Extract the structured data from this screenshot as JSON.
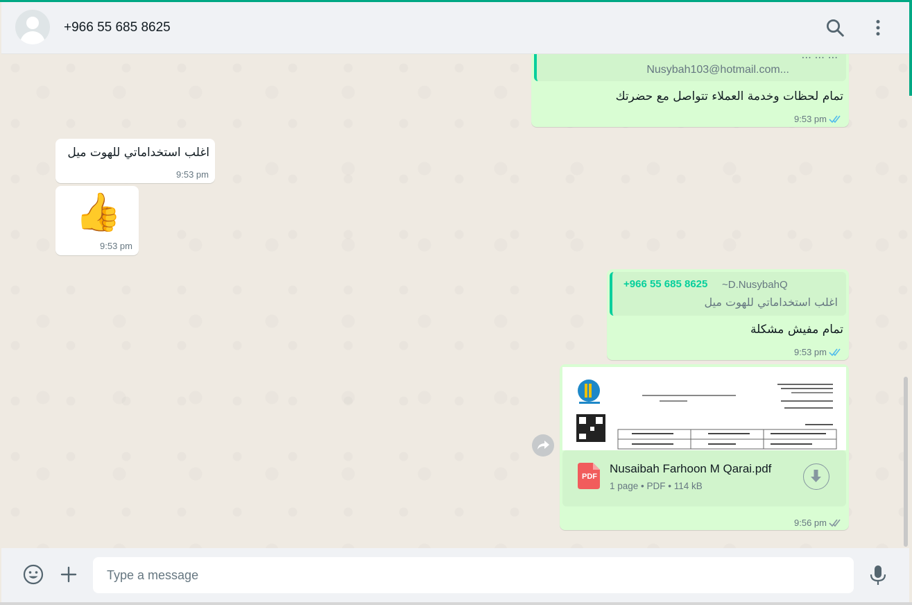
{
  "colors": {
    "accent": "#00a884",
    "outgoing_bubble": "#d9fdd3",
    "incoming_bubble": "#ffffff",
    "read_ticks": "#53bdeb"
  },
  "header": {
    "contact_name": "+966 55 685 8625",
    "icons": [
      "default-avatar",
      "search-icon",
      "menu-icon"
    ]
  },
  "messages": {
    "m1": {
      "quote_line1": "... ... ...",
      "quote_line2": "Nusybah103@hotmail.com...",
      "text": "تمام لحظات وخدمة العملاء تتواصل مع حضرتك",
      "time": "9:53 pm",
      "status": "read"
    },
    "m2": {
      "text": "اغلب استخداماتي للهوت ميل",
      "time": "9:53 pm"
    },
    "m3": {
      "emoji": "👍",
      "time": "9:53 pm"
    },
    "m4": {
      "quote_author": "+966 55 685 8625",
      "quote_alias": "~D.NusybahQ",
      "quote_text": "اغلب استخداماتي للهوت ميل",
      "text": "تمام مفيش مشكلة",
      "time": "9:53 pm",
      "status": "read"
    },
    "m5": {
      "file_name": "Nusaibah Farhoon M Qarai.pdf",
      "file_meta": "1 page • PDF • 114 kB",
      "file_type_badge": "PDF",
      "time": "9:56 pm",
      "status": "delivered"
    }
  },
  "composer": {
    "placeholder": "Type a message",
    "icons": [
      "emoji-icon",
      "attach-icon",
      "mic-icon"
    ]
  }
}
